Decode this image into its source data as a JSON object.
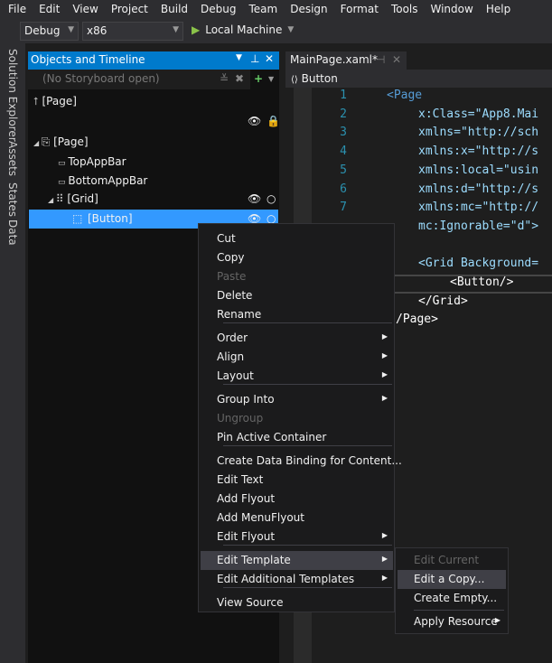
{
  "menubar": [
    "File",
    "Edit",
    "View",
    "Project",
    "Build",
    "Debug",
    "Team",
    "Design",
    "Format",
    "Tools",
    "Window",
    "Help"
  ],
  "toolbar": {
    "config": "Debug",
    "platform": "x86",
    "run_target": "Local Machine"
  },
  "side_tabs": [
    "Solution Explorer",
    "Assets",
    "States",
    "Data"
  ],
  "objects_panel": {
    "title": "Objects and Timeline",
    "storyboard": "(No Storyboard open)",
    "scope": "[Page]",
    "tree": [
      {
        "label": "[Page]"
      },
      {
        "label": "TopAppBar"
      },
      {
        "label": "BottomAppBar"
      },
      {
        "label": "[Grid]"
      },
      {
        "label": "[Button]",
        "selected": true
      }
    ]
  },
  "editor": {
    "tab": "MainPage.xaml*",
    "nav": "Button",
    "line_numbers": [
      "1",
      "2",
      "3",
      "4",
      "5",
      "6",
      "7"
    ],
    "lines": [
      {
        "t": "<Page",
        "c": "#569cd6"
      },
      {
        "t": "x:Class=\"App8.Mai",
        "c": "#9cdcfe"
      },
      {
        "t": "xmlns=\"http://sch",
        "c": "#9cdcfe"
      },
      {
        "t": "xmlns:x=\"http://s",
        "c": "#9cdcfe"
      },
      {
        "t": "xmlns:local=\"usin",
        "c": "#9cdcfe"
      },
      {
        "t": "xmlns:d=\"http://s",
        "c": "#9cdcfe"
      },
      {
        "t": "xmlns:mc=\"http://",
        "c": "#9cdcfe"
      },
      {
        "t": "mc:Ignorable=\"d\">",
        "c": "#9cdcfe"
      },
      {
        "t": "",
        "c": "#fff"
      },
      {
        "t": "<Grid Background=",
        "c": "#9cdcfe"
      },
      {
        "t": "<Button/>",
        "c": "#fff"
      },
      {
        "t": "</Grid>",
        "c": "#fff"
      },
      {
        "t": "/Page>",
        "c": "#fff"
      }
    ]
  },
  "context_menu": [
    {
      "label": "Cut"
    },
    {
      "label": "Copy"
    },
    {
      "label": "Paste",
      "disabled": true
    },
    {
      "label": "Delete"
    },
    {
      "label": "Rename"
    },
    {
      "label": "Order",
      "sub": true
    },
    {
      "label": "Align",
      "sub": true
    },
    {
      "label": "Layout",
      "sub": true
    },
    {
      "label": "Group Into",
      "sub": true
    },
    {
      "label": "Ungroup",
      "disabled": true
    },
    {
      "label": "Pin Active Container"
    },
    {
      "label": "Create Data Binding for Content..."
    },
    {
      "label": "Edit Text"
    },
    {
      "label": "Add Flyout"
    },
    {
      "label": "Add MenuFlyout"
    },
    {
      "label": "Edit Flyout",
      "sub": true
    },
    {
      "label": "Edit Template",
      "sub": true,
      "highlighted": true
    },
    {
      "label": "Edit Additional Templates",
      "sub": true
    },
    {
      "label": "View Source"
    }
  ],
  "submenu": [
    {
      "label": "Edit Current",
      "disabled": true
    },
    {
      "label": "Edit a Copy...",
      "highlighted": true
    },
    {
      "label": "Create Empty..."
    },
    {
      "label": "Apply Resource",
      "sub": true
    }
  ],
  "colors": {
    "accent": "#007acc",
    "selection": "#3399ff"
  }
}
